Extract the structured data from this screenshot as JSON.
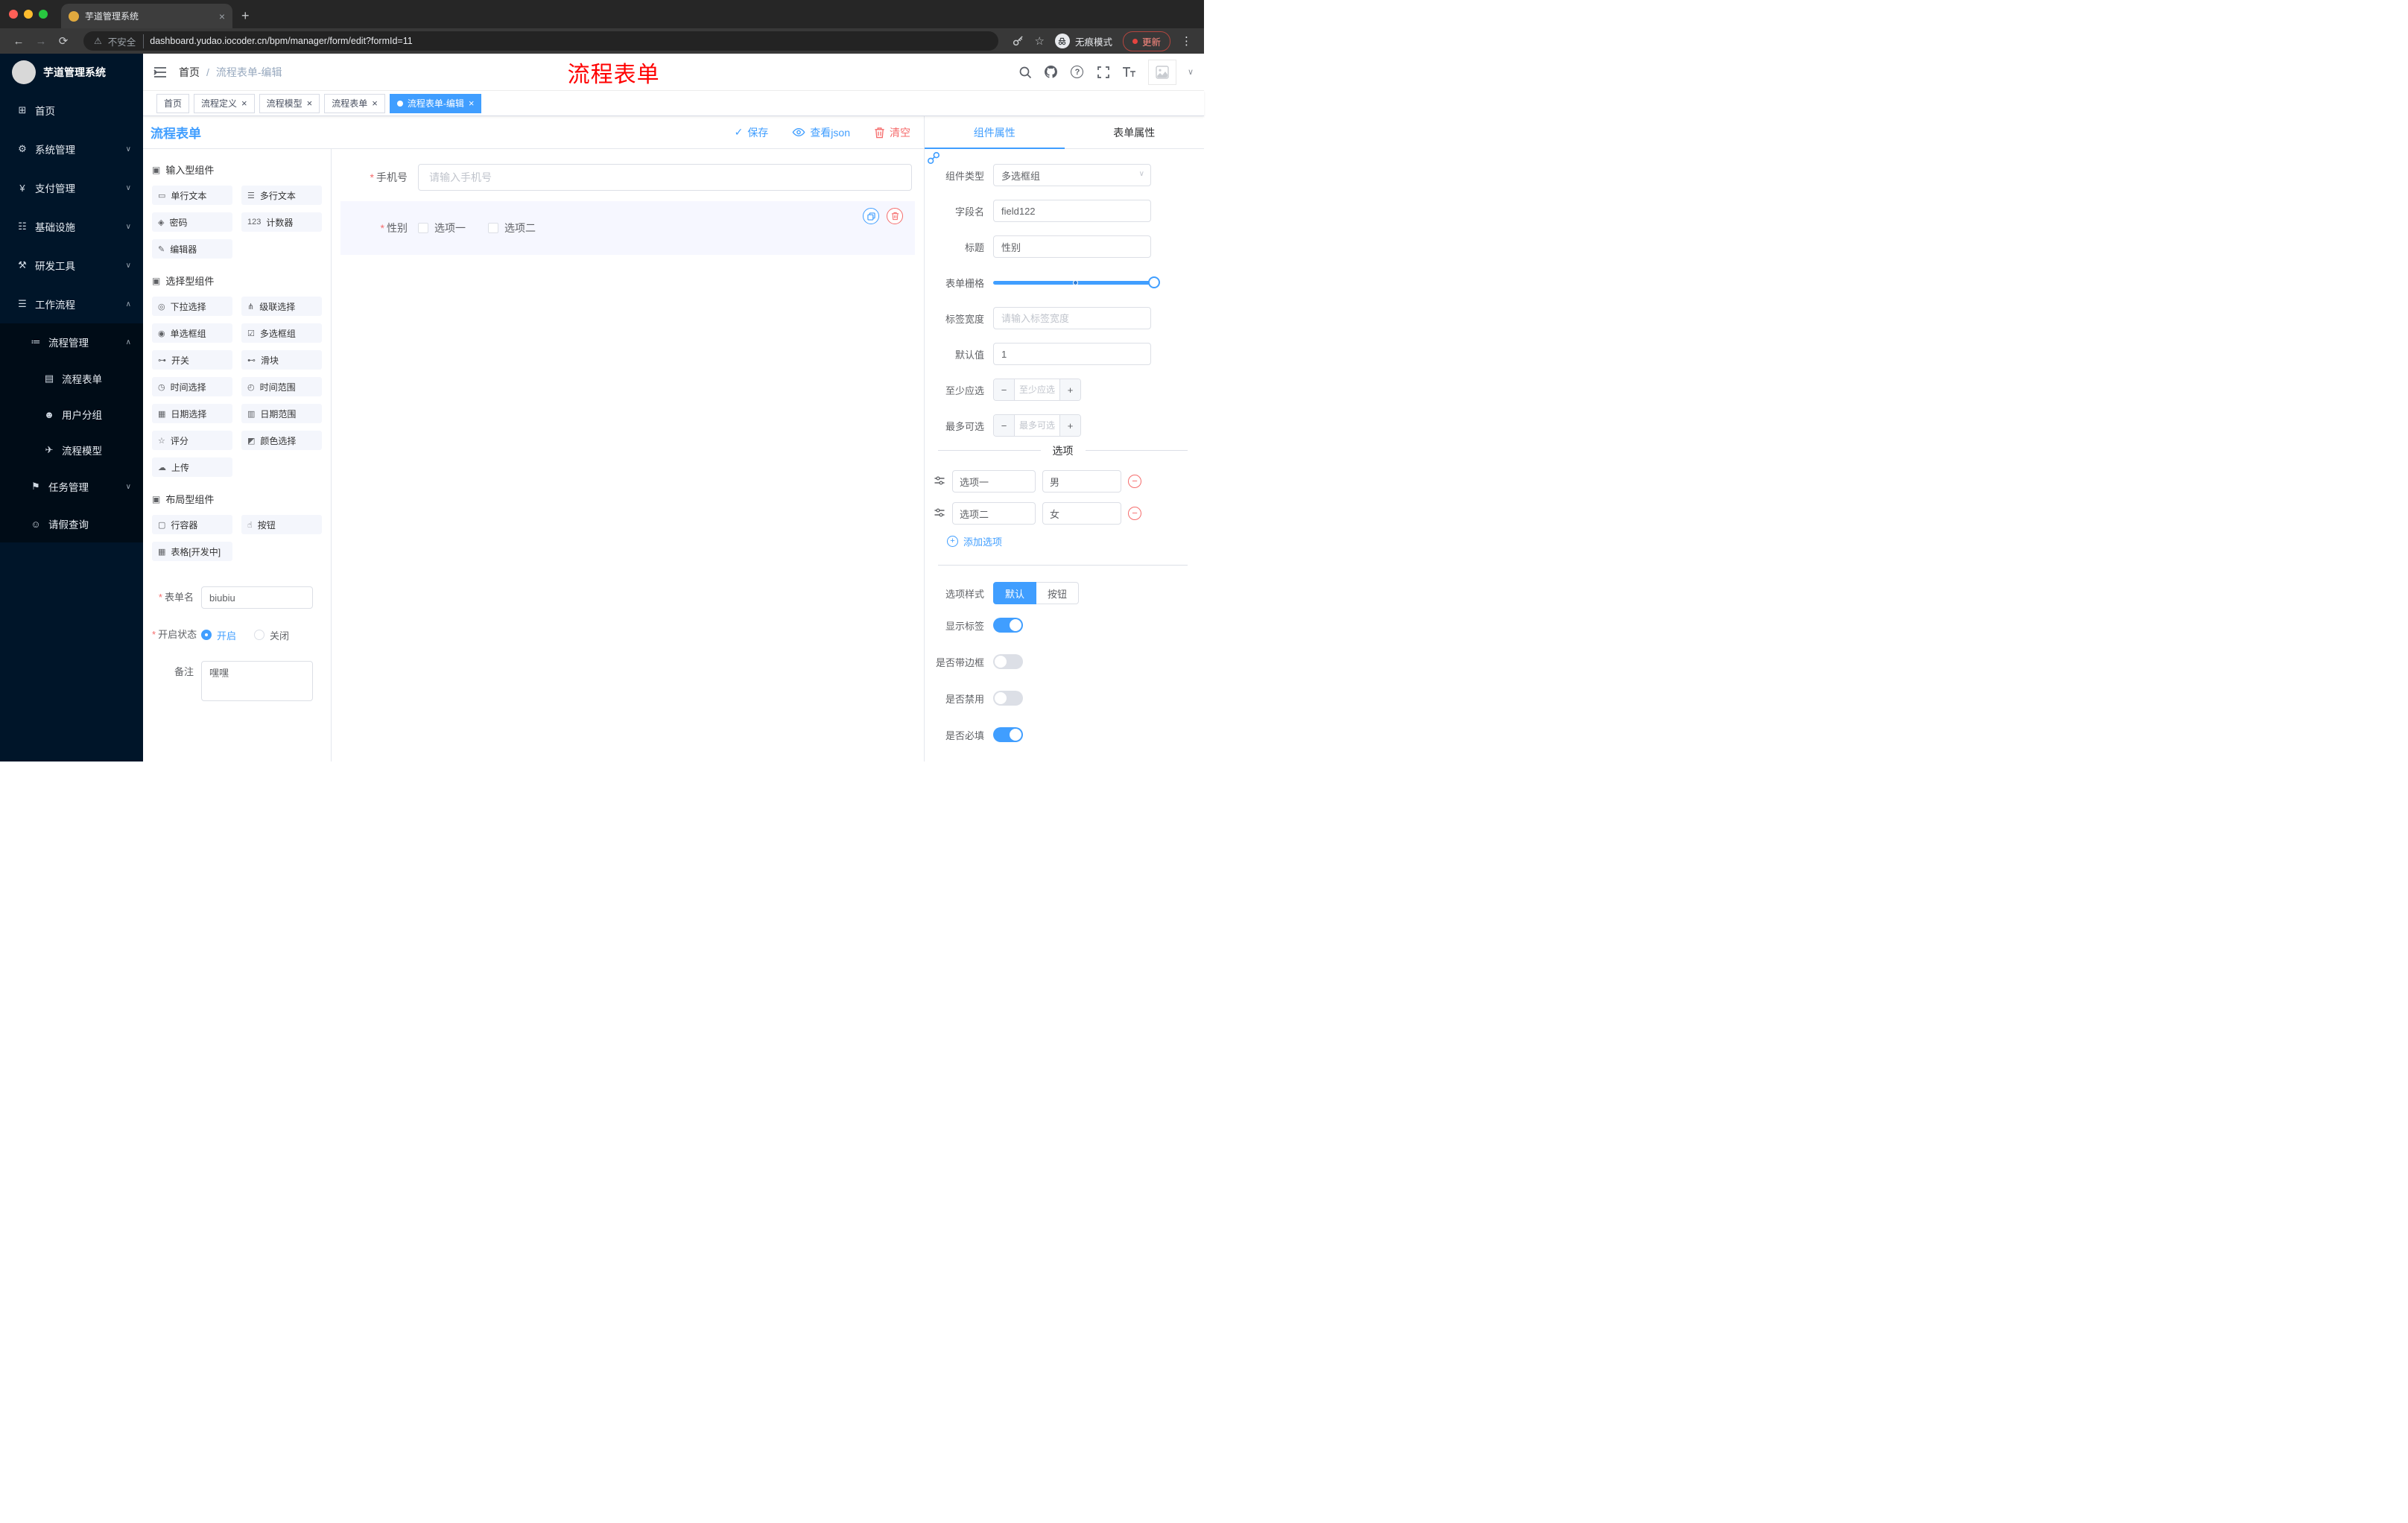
{
  "browser": {
    "tab_title": "芋道管理系统",
    "security_label": "不安全",
    "url": "dashboard.yudao.iocoder.cn/bpm/manager/form/edit?formId=11",
    "incognito_label": "无痕模式",
    "update_label": "更新"
  },
  "icons": {
    "warning": "⚠",
    "back": "←",
    "forward": "→",
    "reload": "⟳",
    "star": "☆",
    "plus": "+",
    "minus": "−",
    "close": "×",
    "kebab": "⋮",
    "caret_down": "∨",
    "caret_up": "∧",
    "check": "✓",
    "question": "?"
  },
  "sidebar": {
    "logo_title": "芋道管理系统",
    "items": [
      {
        "label": "首页",
        "icon": "⊞",
        "chev": ""
      },
      {
        "label": "系统管理",
        "icon": "⚙",
        "chev": "∨"
      },
      {
        "label": "支付管理",
        "icon": "¥",
        "chev": "∨"
      },
      {
        "label": "基础设施",
        "icon": "☷",
        "chev": "∨"
      },
      {
        "label": "研发工具",
        "icon": "⚒",
        "chev": "∨"
      },
      {
        "label": "工作流程",
        "icon": "☰",
        "chev": "∧"
      },
      {
        "label": "流程管理",
        "icon": "≔",
        "chev": "∧"
      },
      {
        "label": "流程表单",
        "icon": "▤",
        "chev": ""
      },
      {
        "label": "用户分组",
        "icon": "☻",
        "chev": ""
      },
      {
        "label": "流程模型",
        "icon": "✈",
        "chev": ""
      },
      {
        "label": "任务管理",
        "icon": "⚑",
        "chev": "∨"
      },
      {
        "label": "请假查询",
        "icon": "☺",
        "chev": ""
      }
    ]
  },
  "header": {
    "breadcrumb_home": "首页",
    "breadcrumb_sep": "/",
    "breadcrumb_current": "流程表单-编辑",
    "overlay_title": "流程表单"
  },
  "tags": [
    {
      "label": "首页"
    },
    {
      "label": "流程定义"
    },
    {
      "label": "流程模型"
    },
    {
      "label": "流程表单"
    },
    {
      "label": "流程表单-编辑"
    }
  ],
  "designer": {
    "title": "流程表单",
    "actions": {
      "save": "保存",
      "view_json": "查看json",
      "clear": "清空"
    },
    "palette": {
      "sections": [
        {
          "title": "输入型组件",
          "items": [
            {
              "label": "单行文本",
              "icon": "▭"
            },
            {
              "label": "多行文本",
              "icon": "☰"
            },
            {
              "label": "密码",
              "icon": "◈"
            },
            {
              "label": "计数器",
              "icon": "123"
            },
            {
              "label": "编辑器",
              "icon": "✎"
            }
          ]
        },
        {
          "title": "选择型组件",
          "items": [
            {
              "label": "下拉选择",
              "icon": "◎"
            },
            {
              "label": "级联选择",
              "icon": "⋔"
            },
            {
              "label": "单选框组",
              "icon": "◉"
            },
            {
              "label": "多选框组",
              "icon": "☑"
            },
            {
              "label": "开关",
              "icon": "⊶"
            },
            {
              "label": "滑块",
              "icon": "⊷"
            },
            {
              "label": "时间选择",
              "icon": "◷"
            },
            {
              "label": "时间范围",
              "icon": "◴"
            },
            {
              "label": "日期选择",
              "icon": "▦"
            },
            {
              "label": "日期范围",
              "icon": "▥"
            },
            {
              "label": "评分",
              "icon": "☆"
            },
            {
              "label": "颜色选择",
              "icon": "◩"
            },
            {
              "label": "上传",
              "icon": "☁"
            }
          ]
        },
        {
          "title": "布局型组件",
          "items": [
            {
              "label": "行容器",
              "icon": "▢"
            },
            {
              "label": "按钮",
              "icon": "☝"
            },
            {
              "label": "表格[开发中]",
              "icon": "▦"
            }
          ]
        }
      ]
    },
    "meta": {
      "name_label": "表单名",
      "name_value": "biubiu",
      "status_label": "开启状态",
      "status_on": "开启",
      "status_off": "关闭",
      "remark_label": "备注",
      "remark_value": "嘿嘿"
    },
    "canvas": {
      "phone": {
        "label": "手机号",
        "placeholder": "请输入手机号"
      },
      "gender": {
        "label": "性别",
        "option1": "选项一",
        "option2": "选项二"
      }
    }
  },
  "props": {
    "tab_component": "组件属性",
    "tab_form": "表单属性",
    "rows": {
      "type_label": "组件类型",
      "type_value": "多选框组",
      "field_label": "字段名",
      "field_value": "field122",
      "title_label": "标题",
      "title_value": "性别",
      "grid_label": "表单栅格",
      "width_label": "标签宽度",
      "width_placeholder": "请输入标签宽度",
      "default_label": "默认值",
      "default_value": "1",
      "min_label": "至少应选",
      "min_placeholder": "至少应选",
      "max_label": "最多可选",
      "max_placeholder": "最多可选"
    },
    "options": {
      "divider": "选项",
      "rows": [
        {
          "label": "选项一",
          "value": "男"
        },
        {
          "label": "选项二",
          "value": "女"
        }
      ],
      "add": "添加选项"
    },
    "style": {
      "label": "选项样式",
      "default": "默认",
      "button": "按钮"
    },
    "switches": [
      {
        "label": "显示标签"
      },
      {
        "label": "是否带边框"
      },
      {
        "label": "是否禁用"
      },
      {
        "label": "是否必填"
      }
    ]
  },
  "colors": {
    "accent": "#409eff",
    "danger": "#f56c6c",
    "sidebar_bg": "#001529",
    "annotation": "#ff0000"
  }
}
